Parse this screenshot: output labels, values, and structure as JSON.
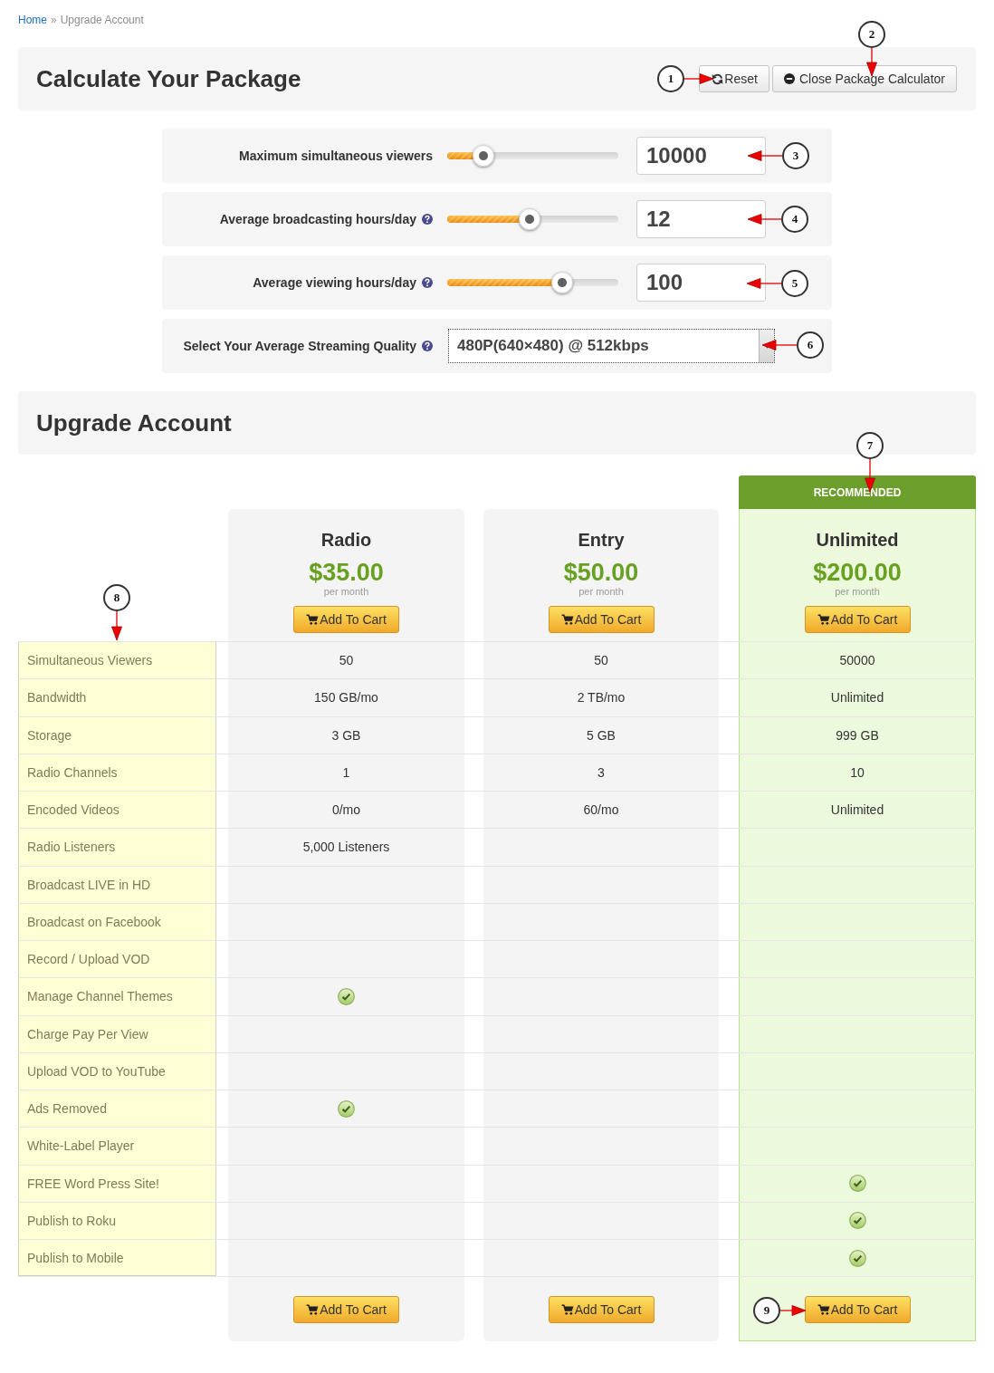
{
  "breadcrumb": {
    "items": [
      {
        "label": "Home",
        "link": true
      },
      {
        "label": "Upgrade Account",
        "link": false
      }
    ],
    "separator": "»"
  },
  "calculator": {
    "title": "Calculate Your Package",
    "buttons": [
      {
        "label": "Reset",
        "kind": "reset"
      },
      {
        "label": "Close Package Calculator",
        "kind": "close"
      }
    ],
    "sliders": [
      {
        "label": "Maximum simultaneous viewers",
        "help": false,
        "level": 0.21,
        "value": "10000"
      },
      {
        "label": "Average broadcasting hours/day",
        "help": true,
        "level": 0.48,
        "value": "12"
      },
      {
        "label": "Average viewing hours/day",
        "help": true,
        "level": 0.67,
        "value": "100"
      }
    ],
    "quality": {
      "label": "Select Your Average Streaming Quality",
      "help": true,
      "value": "480P(640×480) @ 512kbps"
    }
  },
  "upgrade": {
    "title": "Upgrade Account",
    "plans": [
      {
        "name": "Radio",
        "price": "$35.00",
        "period": "per month",
        "button": "Add To Cart",
        "footer_button": "Add To Cart",
        "recommended": false
      },
      {
        "name": "Entry",
        "price": "$50.00",
        "period": "per month",
        "button": "Add To Cart",
        "footer_button": "Add To Cart",
        "recommended": false
      },
      {
        "name": "Unlimited",
        "price": "$200.00",
        "period": "per month",
        "button": "Add To Cart",
        "footer_button": "Add To Cart",
        "recommended": true,
        "badge": "RECOMMENDED"
      }
    ],
    "features": [
      {
        "label": "Simultaneous Viewers",
        "cells": [
          {
            "kind": "text",
            "text": "50"
          },
          {
            "kind": "text",
            "text": "50"
          },
          {
            "kind": "text",
            "text": "50000"
          }
        ]
      },
      {
        "label": "Bandwidth",
        "cells": [
          {
            "kind": "text",
            "text": "150 GB/mo"
          },
          {
            "kind": "text",
            "text": "2 TB/mo"
          },
          {
            "kind": "text",
            "text": "Unlimited"
          }
        ]
      },
      {
        "label": "Storage",
        "cells": [
          {
            "kind": "text",
            "text": "3 GB"
          },
          {
            "kind": "text",
            "text": "5 GB"
          },
          {
            "kind": "text",
            "text": "999 GB"
          }
        ]
      },
      {
        "label": "Radio Channels",
        "cells": [
          {
            "kind": "text",
            "text": "1"
          },
          {
            "kind": "text",
            "text": "3"
          },
          {
            "kind": "text",
            "text": "10"
          }
        ]
      },
      {
        "label": "Encoded Videos",
        "cells": [
          {
            "kind": "text",
            "text": "0/mo"
          },
          {
            "kind": "text",
            "text": "60/mo"
          },
          {
            "kind": "text",
            "text": "Unlimited"
          }
        ]
      },
      {
        "label": "Radio Listeners",
        "cells": [
          {
            "kind": "text",
            "text": "5,000 Listeners"
          },
          {
            "kind": "check",
            "checked": false
          },
          {
            "kind": "check",
            "checked": false
          }
        ]
      },
      {
        "label": "Broadcast LIVE in HD",
        "cells": [
          {
            "kind": "check",
            "checked": false
          },
          {
            "kind": "check",
            "checked": false
          },
          {
            "kind": "check",
            "checked": false
          }
        ]
      },
      {
        "label": "Broadcast on Facebook",
        "cells": [
          {
            "kind": "check",
            "checked": false
          },
          {
            "kind": "check",
            "checked": false
          },
          {
            "kind": "check",
            "checked": false
          }
        ]
      },
      {
        "label": "Record / Upload VOD",
        "cells": [
          {
            "kind": "check",
            "checked": false
          },
          {
            "kind": "check",
            "checked": false
          },
          {
            "kind": "check",
            "checked": false
          }
        ]
      },
      {
        "label": "Manage Channel Themes",
        "cells": [
          {
            "kind": "check",
            "checked": true
          },
          {
            "kind": "check",
            "checked": false
          },
          {
            "kind": "check",
            "checked": false
          }
        ]
      },
      {
        "label": "Charge Pay Per View",
        "cells": [
          {
            "kind": "check",
            "checked": false
          },
          {
            "kind": "check",
            "checked": false
          },
          {
            "kind": "check",
            "checked": false
          }
        ]
      },
      {
        "label": "Upload VOD to YouTube",
        "cells": [
          {
            "kind": "check",
            "checked": false
          },
          {
            "kind": "check",
            "checked": false
          },
          {
            "kind": "check",
            "checked": false
          }
        ]
      },
      {
        "label": "Ads Removed",
        "cells": [
          {
            "kind": "check",
            "checked": true
          },
          {
            "kind": "check",
            "checked": false
          },
          {
            "kind": "check",
            "checked": false
          }
        ]
      },
      {
        "label": "White-Label Player",
        "cells": [
          {
            "kind": "check",
            "checked": false
          },
          {
            "kind": "check",
            "checked": false
          },
          {
            "kind": "check",
            "checked": false
          }
        ]
      },
      {
        "label": "FREE Word Press Site!",
        "cells": [
          {
            "kind": "check",
            "checked": false
          },
          {
            "kind": "check",
            "checked": false
          },
          {
            "kind": "check",
            "checked": true
          }
        ]
      },
      {
        "label": "Publish to Roku",
        "cells": [
          {
            "kind": "check",
            "checked": false
          },
          {
            "kind": "check",
            "checked": false
          },
          {
            "kind": "check",
            "checked": true
          }
        ]
      },
      {
        "label": "Publish to Mobile",
        "cells": [
          {
            "kind": "check",
            "checked": false
          },
          {
            "kind": "check",
            "checked": false
          },
          {
            "kind": "check",
            "checked": true
          }
        ]
      }
    ]
  },
  "callouts": [
    {
      "label": "1"
    },
    {
      "label": "2"
    },
    {
      "label": "3"
    },
    {
      "label": "4"
    },
    {
      "label": "5"
    },
    {
      "label": "6"
    },
    {
      "label": "7"
    },
    {
      "label": "8"
    },
    {
      "label": "9"
    }
  ]
}
